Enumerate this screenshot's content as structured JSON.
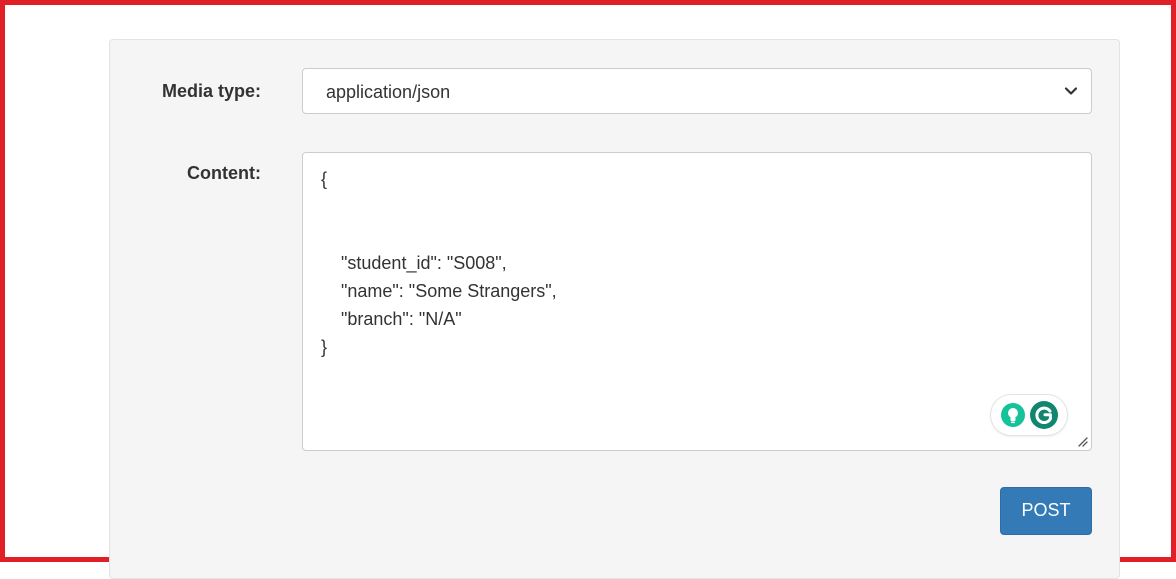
{
  "form": {
    "media_type_label": "Media type:",
    "media_type_value": "application/json",
    "content_label": "Content:",
    "content_value": "{\n\n\n    \"student_id\": \"S008\",\n    \"name\": \"Some Strangers\",\n    \"branch\": \"N/A\"\n}",
    "post_label": "POST"
  },
  "icons": {
    "select_arrow": "chevron-down-icon",
    "grammarly_suggest": "lightbulb-icon",
    "grammarly_logo": "grammarly-icon",
    "resize": "resize-handle-icon"
  },
  "colors": {
    "frame_border": "#e11f26",
    "button": "#337ab7",
    "grammarly_green": "#15c39a"
  }
}
